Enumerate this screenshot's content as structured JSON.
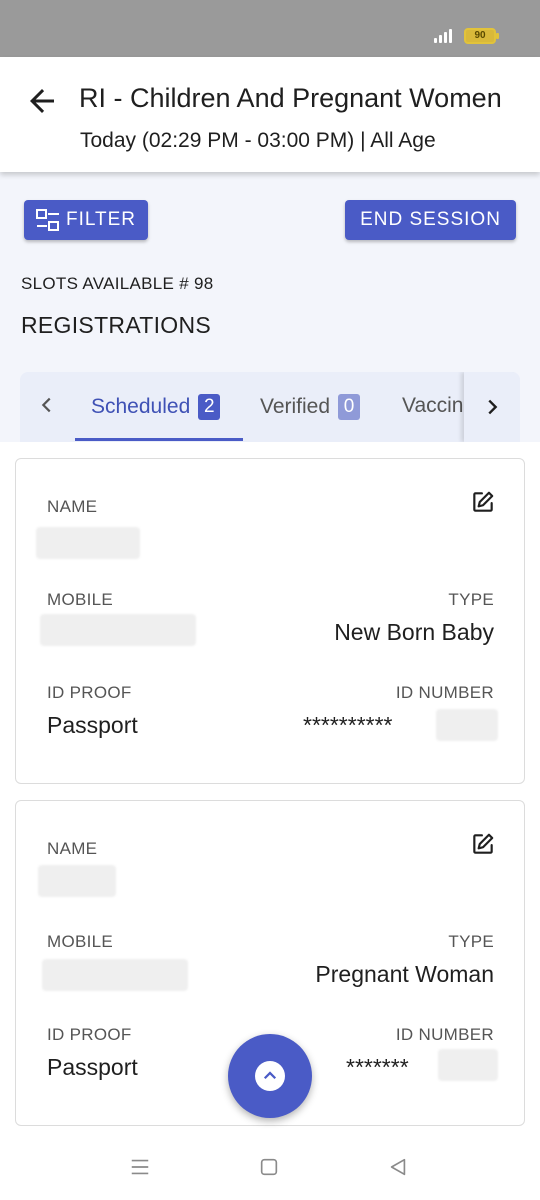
{
  "status": {
    "battery": "90"
  },
  "header": {
    "title": "RI - Children And Pregnant Women",
    "subtitle": "Today (02:29 PM - 03:00 PM) | All Age"
  },
  "actions": {
    "filter_label": "FILTER",
    "end_session_label": "END SESSION"
  },
  "slots_text": "SLOTS AVAILABLE # 98",
  "section_title": "REGISTRATIONS",
  "tabs": [
    {
      "label": "Scheduled",
      "count": "2",
      "selected": true
    },
    {
      "label": "Verified",
      "count": "0",
      "selected": false
    },
    {
      "label": "Vaccin",
      "count": "",
      "selected": false
    }
  ],
  "field_labels": {
    "name": "NAME",
    "mobile": "MOBILE",
    "type": "TYPE",
    "id_proof": "ID PROOF",
    "id_number": "ID NUMBER"
  },
  "registrations": [
    {
      "type": "New Born Baby",
      "id_proof": "Passport",
      "id_number": "**********"
    },
    {
      "type": "Pregnant Woman",
      "id_proof": "Passport",
      "id_number": "*******"
    }
  ],
  "colors": {
    "accent": "#4a5bc6",
    "status_bar": "#9a9a9a",
    "background": "#f3f5fb"
  },
  "icons": [
    "back-arrow-icon",
    "filter-icon",
    "chevron-left-icon",
    "chevron-right-icon",
    "edit-icon",
    "chevron-up-icon",
    "menu-icon",
    "home-square-icon",
    "back-triangle-icon"
  ]
}
